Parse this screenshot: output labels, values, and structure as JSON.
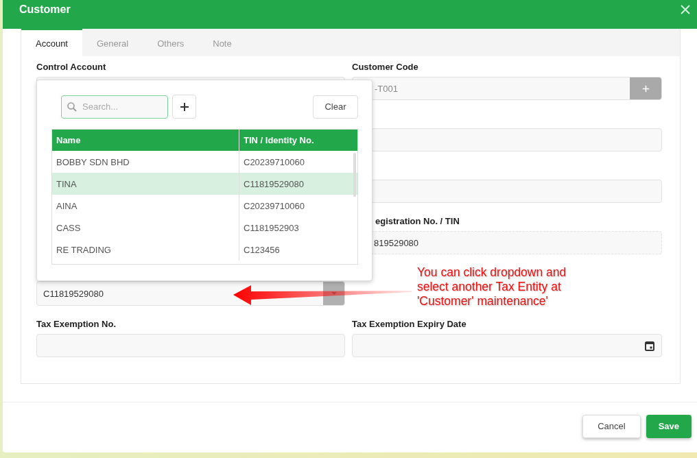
{
  "window": {
    "title": "Customer"
  },
  "tabs": [
    {
      "label": "Account",
      "selected": true
    },
    {
      "label": "General",
      "selected": false
    },
    {
      "label": "Others",
      "selected": false
    },
    {
      "label": "Note",
      "selected": false
    }
  ],
  "form": {
    "control_account": {
      "label": "Control Account"
    },
    "customer_code": {
      "label": "Customer Code",
      "value": "-T001"
    },
    "registration": {
      "label": "egistration No. / TIN",
      "value": "819529080"
    },
    "tax_entity": {
      "value": "C11819529080"
    },
    "tax_exemption_no": {
      "label": "Tax Exemption No."
    },
    "tax_exemption_expiry": {
      "label": "Tax Exemption Expiry Date"
    }
  },
  "dropdown": {
    "search": {
      "placeholder": "Search..."
    },
    "clear_button": "Clear",
    "columns": [
      "Name",
      "TIN / Identity No."
    ],
    "rows": [
      {
        "name": "BOBBY SDN BHD",
        "tin": "C20239710060",
        "selected": false
      },
      {
        "name": "TINA",
        "tin": "C11819529080",
        "selected": true
      },
      {
        "name": "AINA",
        "tin": "C20239710060",
        "selected": false
      },
      {
        "name": "CASS",
        "tin": "C1181952903",
        "selected": false
      },
      {
        "name": "RE TRADING",
        "tin": "C123456",
        "selected": false
      }
    ]
  },
  "annotation": {
    "lines": [
      "You can click dropdown and",
      "select another Tax Entity at",
      "'Customer' maintenance'"
    ]
  },
  "buttons": [
    {
      "label": "Cancel",
      "kind": "secondary"
    },
    {
      "label": "Save",
      "kind": "primary"
    }
  ]
}
